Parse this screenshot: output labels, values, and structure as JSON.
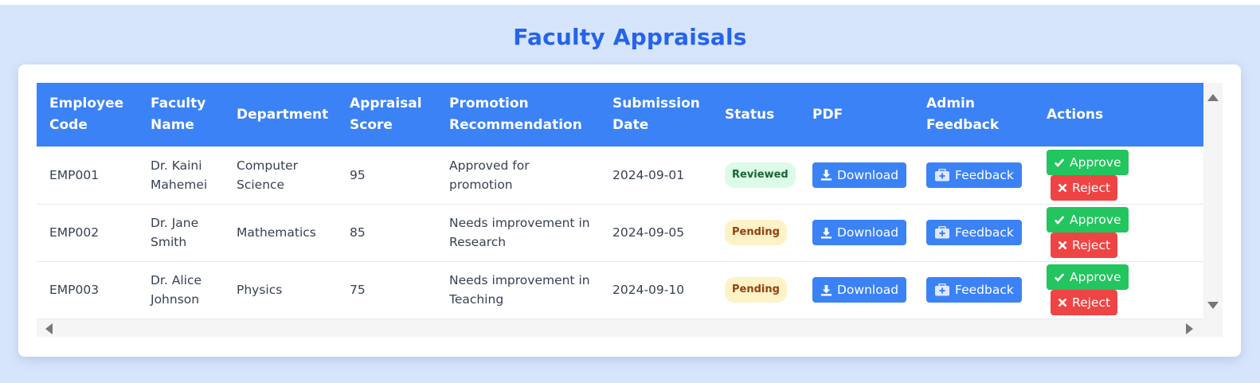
{
  "page": {
    "title": "Faculty Appraisals"
  },
  "table": {
    "headers": {
      "employee_code": "Employee Code",
      "faculty_name": "Faculty Name",
      "department": "Department",
      "appraisal_score": "Appraisal Score",
      "promotion_recommendation": "Promotion Recommendation",
      "submission_date": "Submission Date",
      "status": "Status",
      "pdf": "PDF",
      "admin_feedback": "Admin Feedback",
      "actions": "Actions"
    },
    "rows": [
      {
        "employee_code": "EMP001",
        "faculty_name": "Dr. Kaini Mahemei",
        "department": "Computer Science",
        "appraisal_score": "95",
        "promotion_recommendation": "Approved for promotion",
        "submission_date": "2024-09-01",
        "status": "Reviewed"
      },
      {
        "employee_code": "EMP002",
        "faculty_name": "Dr. Jane Smith",
        "department": "Mathematics",
        "appraisal_score": "85",
        "promotion_recommendation": "Needs improvement in Research",
        "submission_date": "2024-09-05",
        "status": "Pending"
      },
      {
        "employee_code": "EMP003",
        "faculty_name": "Dr. Alice Johnson",
        "department": "Physics",
        "appraisal_score": "75",
        "promotion_recommendation": "Needs improvement in Teaching",
        "submission_date": "2024-09-10",
        "status": "Pending"
      }
    ],
    "buttons": {
      "download": "Download",
      "feedback": "Feedback",
      "approve": "Approve",
      "reject": "Reject"
    },
    "icons": {
      "download": "download-icon",
      "feedback": "medical-kit-icon",
      "approve": "check-icon",
      "reject": "x-icon"
    }
  },
  "colors": {
    "title": "#2563eb",
    "header_bg": "#3b82f6",
    "button_blue": "#3b82f6",
    "button_green": "#22c55e",
    "button_red": "#ef4444",
    "badge_reviewed_bg": "#dcfce7",
    "badge_pending_bg": "#fef3c7",
    "page_bg": "#d6e5fb"
  }
}
